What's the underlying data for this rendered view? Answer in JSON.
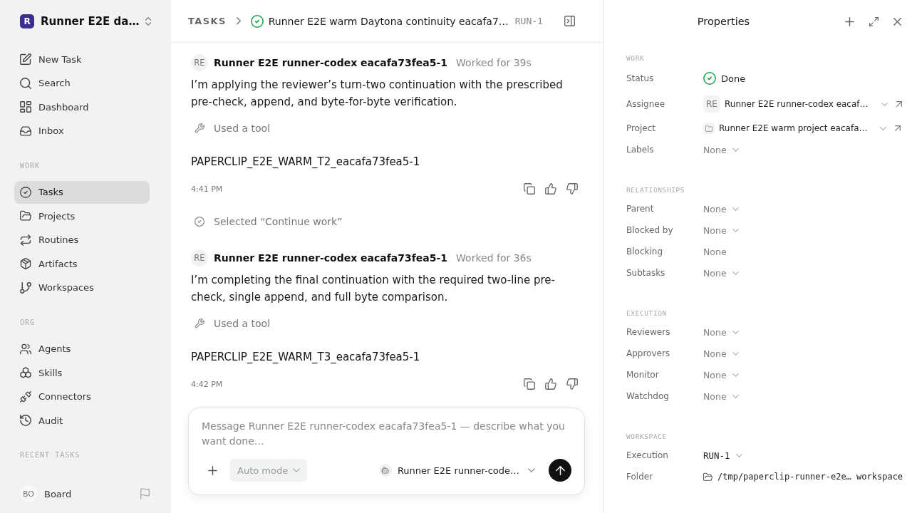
{
  "sidebar": {
    "workspace": {
      "initial": "R",
      "name": "Runner E2E da…"
    },
    "sections": [
      {
        "items": [
          {
            "label": "New Task",
            "selected": false
          },
          {
            "label": "Search",
            "selected": false
          },
          {
            "label": "Dashboard",
            "selected": false
          },
          {
            "label": "Inbox",
            "selected": false
          }
        ]
      },
      {
        "title": "WORK",
        "items": [
          {
            "label": "Tasks",
            "selected": true
          },
          {
            "label": "Projects",
            "selected": false
          },
          {
            "label": "Routines",
            "selected": false
          },
          {
            "label": "Artifacts",
            "selected": false
          },
          {
            "label": "Workspaces",
            "selected": false
          }
        ]
      },
      {
        "title": "ORG",
        "items": [
          {
            "label": "Agents",
            "selected": false
          },
          {
            "label": "Skills",
            "selected": false
          },
          {
            "label": "Connectors",
            "selected": false
          },
          {
            "label": "Audit",
            "selected": false
          }
        ]
      },
      {
        "title": "RECENT TASKS"
      }
    ],
    "user": {
      "initials": "BO",
      "name": "Board"
    }
  },
  "header": {
    "breadcrumb": "TASKS",
    "title": "Runner E2E warm Daytona continuity eacafa7…",
    "run": "RUN-1"
  },
  "messages": [
    {
      "kind": "agent",
      "avatar": "RE",
      "author": "Runner E2E runner-codex eacafa73fea5-1",
      "duration": "Worked for 39s",
      "body": "I’m applying the reviewer’s turn-two continuation with the prescribed pre-check, append, and byte-for-byte verification.",
      "tool": "Used a tool",
      "output": "PAPERCLIP_E2E_WARM_T2_eacafa73fea5-1",
      "time": "4:41 PM"
    },
    {
      "kind": "choice",
      "text": "Selected “Continue work”"
    },
    {
      "kind": "agent",
      "avatar": "RE",
      "author": "Runner E2E runner-codex eacafa73fea5-1",
      "duration": "Worked for 36s",
      "body": "I’m completing the final continuation with the required two-line pre-check, single append, and full byte comparison.",
      "tool": "Used a tool",
      "output": "PAPERCLIP_E2E_WARM_T3_eacafa73fea5-1",
      "time": "4:42 PM"
    }
  ],
  "composer": {
    "placeholder": "Message Runner E2E runner-codex eacafa73fea5-1 — describe what you want done…",
    "mode": "Auto mode",
    "agent": "Runner E2E runner-code…"
  },
  "properties": {
    "title": "Properties",
    "sections": [
      {
        "title": "WORK",
        "rows": [
          {
            "label": "Status",
            "kind": "status",
            "value": "Done"
          },
          {
            "label": "Assignee",
            "kind": "agent",
            "avatar": "RE",
            "value": "Runner E2E runner-codex eacaf…"
          },
          {
            "label": "Project",
            "kind": "project",
            "value": "Runner E2E warm project eacafa…"
          },
          {
            "label": "Labels",
            "kind": "select",
            "value": "None"
          }
        ]
      },
      {
        "title": "RELATIONSHIPS",
        "rows": [
          {
            "label": "Parent",
            "kind": "select",
            "value": "None"
          },
          {
            "label": "Blocked by",
            "kind": "select",
            "value": "None"
          },
          {
            "label": "Blocking",
            "kind": "text",
            "value": "None"
          },
          {
            "label": "Subtasks",
            "kind": "select",
            "value": "None"
          }
        ]
      },
      {
        "title": "EXECUTION",
        "rows": [
          {
            "label": "Reviewers",
            "kind": "select",
            "value": "None"
          },
          {
            "label": "Approvers",
            "kind": "select",
            "value": "None"
          },
          {
            "label": "Monitor",
            "kind": "select",
            "value": "None"
          },
          {
            "label": "Watchdog",
            "kind": "select",
            "value": "None"
          }
        ]
      },
      {
        "title": "WORKSPACE",
        "rows": [
          {
            "label": "Execution",
            "kind": "run",
            "value": "RUN-1"
          },
          {
            "label": "Folder",
            "kind": "folder",
            "value": "/tmp/paperclip-runner-e2e… workspace"
          }
        ]
      }
    ]
  }
}
